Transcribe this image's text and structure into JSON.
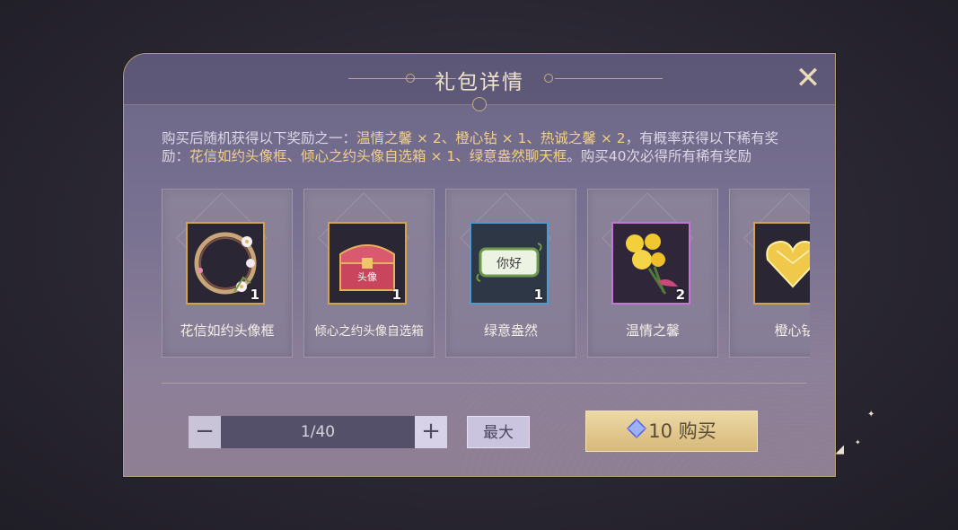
{
  "dialog": {
    "title": "礼包详情",
    "close_icon": "close-icon"
  },
  "description": {
    "part1": "购买后随机获得以下奖励之一：",
    "hl1": "温情之馨 × 2、橙心钻 × 1、热诚之馨 × 2",
    "part2": "，有概率获得以下稀有奖励：",
    "hl2": "花信如约头像框、倾心之约头像自选箱 × 1、绿意盎然聊天框",
    "part3": "。购买40次必得所有稀有奖励"
  },
  "rewards": [
    {
      "name": "花信如约头像框",
      "qty": "1",
      "icon": "flower-avatar-frame-icon",
      "rarity_color": "#d3a24d"
    },
    {
      "name": "倾心之约头像自选箱",
      "qty": "1",
      "icon": "avatar-chest-icon",
      "chest_label": "头像",
      "rarity_color": "#d3a24d"
    },
    {
      "name": "绿意盎然",
      "qty": "1",
      "icon": "chat-bubble-icon",
      "bubble_text": "你好",
      "rarity_color": "#4b9bd3"
    },
    {
      "name": "温情之馨",
      "qty": "2",
      "icon": "yellow-roses-icon",
      "rarity_color": "#c774d6"
    },
    {
      "name": "橙心钻",
      "qty": "",
      "icon": "heart-diamond-icon",
      "rarity_color": "#d3a24d"
    }
  ],
  "stepper": {
    "value": "1/40",
    "minus_label": "−",
    "plus_label": "+"
  },
  "max_button": {
    "label": "最大"
  },
  "buy_button": {
    "price": "10",
    "label": "购买",
    "icon": "diamond-currency-icon"
  }
}
